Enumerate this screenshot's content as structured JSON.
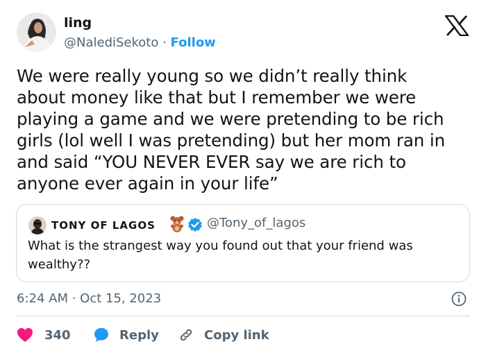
{
  "author": {
    "display_name": "ling",
    "handle": "@NalediSekoto",
    "separator": " · ",
    "follow_label": "Follow"
  },
  "tweet": {
    "text": "We were really young so we didn’t really think\nabout money like that but I remember we were\nplaying a game and we were pretending to be rich\ngirls (lol well I was pretending) but her mom ran in\nand said “YOU NEVER EVER say we are rich to\nanyone ever again in your life”",
    "timestamp": "6:24 AM · Oct 15, 2023"
  },
  "quote": {
    "display_name": "TONY OF LAGOS",
    "handle": "@Tony_of_lagos",
    "text": "What is the strangest way you found out that your friend was wealthy??"
  },
  "actions": {
    "like_count": "340",
    "reply_label": "Reply",
    "copy_link_label": "Copy link"
  },
  "colors": {
    "accent": "#1d9bf0",
    "like": "#f91880",
    "text_secondary": "#536471",
    "border": "#cfd9de"
  },
  "icons": [
    "x-logo-icon",
    "verified-badge-icon",
    "teddy-bear-emoji-icon",
    "info-icon",
    "heart-icon",
    "reply-bubble-icon",
    "link-icon"
  ]
}
